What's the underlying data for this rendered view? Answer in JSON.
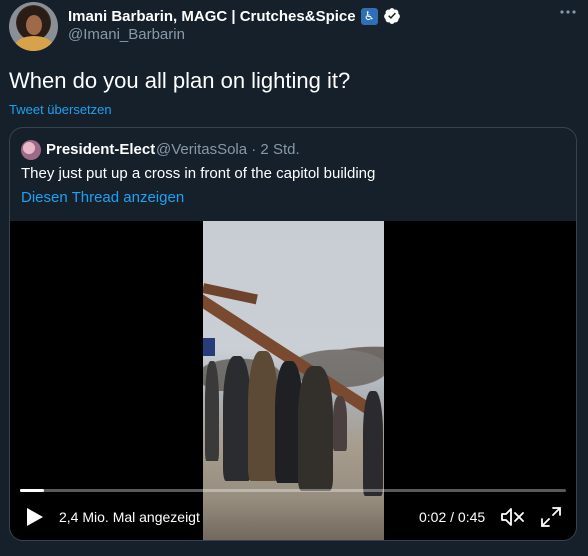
{
  "author": {
    "name": "Imani Barbarin, MAGC | Crutches&Spice",
    "name_emoji": "♿",
    "handle": "@Imani_Barbarin",
    "verified": true
  },
  "tweet": {
    "text": "When do you all plan on lighting it?",
    "translate_label": "Tweet übersetzen"
  },
  "quoted": {
    "name": "President-Elect",
    "meta": "@VeritasSola · 2 Std.",
    "text": "They just put up a cross in front of the capitol building",
    "thread_link": "Diesen Thread anzeigen"
  },
  "video": {
    "views": "2,4 Mio. Mal angezeigt",
    "time": "0:02 / 0:45",
    "progress": 0.044
  },
  "icons": {
    "more": "more-icon",
    "verified": "verified-icon",
    "play": "play-icon",
    "mute": "mute-icon",
    "fullscreen": "fullscreen-icon"
  },
  "colors": {
    "background": "#15202b",
    "link": "#1da1f2",
    "muted_text": "#8899a6",
    "border": "#38444d"
  }
}
